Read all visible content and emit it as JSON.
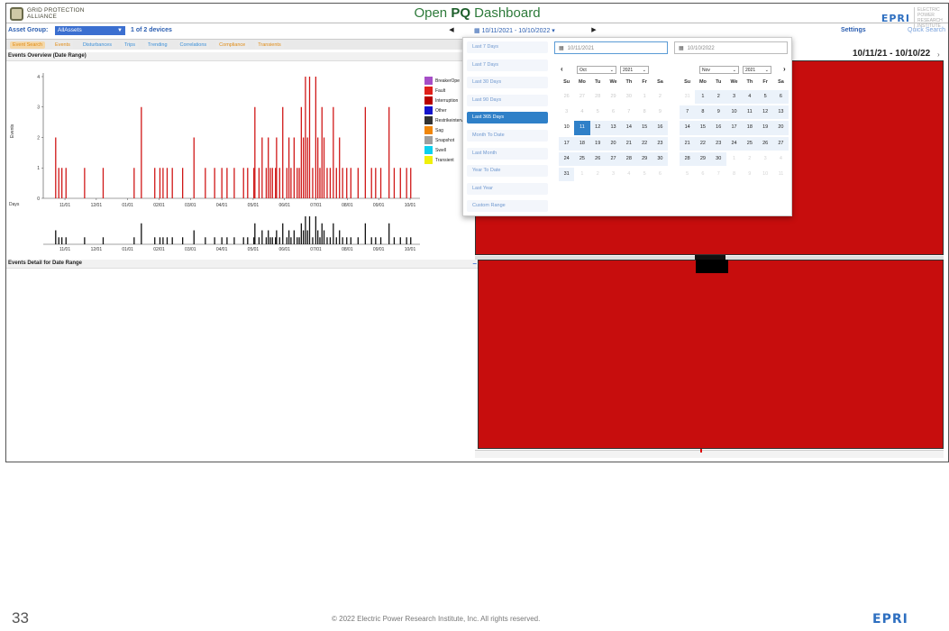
{
  "header": {
    "org_line1": "GRID PROTECTION",
    "org_line2": "ALLIANCE",
    "title_pre": "Open ",
    "title_bold": "PQ",
    "title_post": " Dashboard",
    "epri": "EPRI",
    "epri_tagline": "ELECTRIC POWER RESEARCH INSTITUTE"
  },
  "toolbar": {
    "asset_label": "Asset Group:",
    "asset_value": "AllAssets",
    "devices": "1 of 2 devices",
    "prev": "◀",
    "date_range": "10/11/2021 - 10/10/2022",
    "next": "▶",
    "settings": "Settings",
    "quick_search": "Quick Search"
  },
  "tabs": [
    {
      "label": "Event Search",
      "color": "#e08a12",
      "bg": "#f4d7a8"
    },
    {
      "label": "Events",
      "color": "#e08a12",
      "bg": "#eaeaea"
    },
    {
      "label": "Disturbances",
      "color": "#3b8fd8",
      "bg": "#eaeaea"
    },
    {
      "label": "Trips",
      "color": "#3b8fd8",
      "bg": "#eaeaea"
    },
    {
      "label": "Trending",
      "color": "#3b8fd8",
      "bg": "#eaeaea"
    },
    {
      "label": "Correlations",
      "color": "#3b8fd8",
      "bg": "#eaeaea"
    },
    {
      "label": "Compliance",
      "color": "#e08a12",
      "bg": "#eaeaea"
    },
    {
      "label": "Transients",
      "color": "#e08a12",
      "bg": "#eaeaea"
    }
  ],
  "overview": {
    "title": "Events Overview (Date Range)",
    "ylabel": "Events",
    "days_label": "Days",
    "ticks": [
      "11/01",
      "12/01",
      "01/01",
      "02/01",
      "03/01",
      "04/01",
      "05/01",
      "06/01",
      "07/01",
      "08/01",
      "09/01",
      "10/01"
    ],
    "legend": [
      {
        "label": "BreakerOpe",
        "color": "#a64ec7"
      },
      {
        "label": "Fault",
        "color": "#e0201a"
      },
      {
        "label": "Interruption",
        "color": "#b80000"
      },
      {
        "label": "Other",
        "color": "#1414cc"
      },
      {
        "label": "Restrikeinterval",
        "color": "#333333"
      },
      {
        "label": "Sag",
        "color": "#f0860a"
      },
      {
        "label": "Snapshot",
        "color": "#9e9e9e"
      },
      {
        "label": "Swell",
        "color": "#0cd0ee"
      },
      {
        "label": "Transient",
        "color": "#f0f00a"
      }
    ]
  },
  "chart_data": {
    "type": "bar",
    "xlabel": "Days",
    "ylabel": "Events",
    "ylim": [
      0,
      4
    ],
    "yticks": [
      0,
      1,
      2,
      3,
      4
    ],
    "x_ticks": [
      "11/01",
      "12/01",
      "01/01",
      "02/01",
      "03/01",
      "04/01",
      "05/01",
      "06/01",
      "07/01",
      "08/01",
      "09/01",
      "10/01"
    ],
    "x_range_days": [
      0,
      365
    ],
    "series": [
      {
        "name": "Fault",
        "color": "#d01818",
        "day": [
          12,
          15,
          18,
          22,
          40,
          58,
          88,
          95,
          108,
          113,
          116,
          120,
          125,
          135,
          146,
          157,
          166,
          173,
          178,
          185,
          194,
          198,
          204,
          205,
          209,
          212,
          216,
          218,
          220,
          222,
          225,
          226,
          229,
          232,
          236,
          238,
          240,
          243,
          246,
          248,
          250,
          252,
          254,
          256,
          258,
          261,
          264,
          266,
          268,
          270,
          272,
          275,
          278,
          281,
          284,
          287,
          290,
          294,
          298,
          305,
          312,
          318,
          322,
          327,
          335,
          340,
          346,
          352,
          356
        ],
        "value": [
          2,
          1,
          1,
          1,
          1,
          1,
          1,
          3,
          1,
          1,
          1,
          1,
          1,
          1,
          2,
          1,
          1,
          1,
          1,
          1,
          1,
          1,
          1,
          3,
          1,
          2,
          1,
          2,
          1,
          1,
          1,
          2,
          1,
          3,
          1,
          2,
          1,
          2,
          1,
          1,
          3,
          2,
          4,
          2,
          4,
          1,
          4,
          2,
          1,
          3,
          2,
          1,
          1,
          3,
          1,
          2,
          1,
          1,
          1,
          1,
          3,
          1,
          1,
          1,
          3,
          1,
          1,
          1,
          1
        ]
      }
    ]
  },
  "event_detail": {
    "title": "Events Detail for Date Range",
    "minimize": "–"
  },
  "right_panel": {
    "range_display": "10/11/21 - 10/10/22",
    "scroll_glyph": "›"
  },
  "picker": {
    "ranges": [
      {
        "label": "Last 7 Days",
        "active": false
      },
      {
        "label": "Last 7 Days",
        "active": false
      },
      {
        "label": "Last 30 Days",
        "active": false
      },
      {
        "label": "Last 90 Days",
        "active": false
      },
      {
        "label": "Last 365 Days",
        "active": true
      },
      {
        "label": "Month To Date",
        "active": false
      },
      {
        "label": "Last Month",
        "active": false
      },
      {
        "label": "Year To Date",
        "active": false
      },
      {
        "label": "Last Year",
        "active": false
      },
      {
        "label": "Custom Range",
        "active": false
      }
    ],
    "start_date": "10/11/2021",
    "end_date": "10/10/2022",
    "prev_arrow": "‹",
    "next_arrow": "›",
    "left_month": "Oct",
    "left_year": "2021",
    "right_month": "Nov",
    "right_year": "2021",
    "dow": [
      "Su",
      "Mo",
      "Tu",
      "We",
      "Th",
      "Fr",
      "Sa"
    ],
    "left_weeks": [
      [
        {
          "d": "26",
          "s": "out"
        },
        {
          "d": "27",
          "s": "out"
        },
        {
          "d": "28",
          "s": "out"
        },
        {
          "d": "29",
          "s": "out"
        },
        {
          "d": "30",
          "s": "out"
        },
        {
          "d": "1",
          "s": "out"
        },
        {
          "d": "2",
          "s": "out"
        }
      ],
      [
        {
          "d": "3",
          "s": "out"
        },
        {
          "d": "4",
          "s": "out"
        },
        {
          "d": "5",
          "s": "out"
        },
        {
          "d": "6",
          "s": "out"
        },
        {
          "d": "7",
          "s": "out"
        },
        {
          "d": "8",
          "s": "out"
        },
        {
          "d": "9",
          "s": "out"
        }
      ],
      [
        {
          "d": "10",
          "s": ""
        },
        {
          "d": "11",
          "s": "sel"
        },
        {
          "d": "12",
          "s": "inr"
        },
        {
          "d": "13",
          "s": "inr"
        },
        {
          "d": "14",
          "s": "inr"
        },
        {
          "d": "15",
          "s": "inr"
        },
        {
          "d": "16",
          "s": "inr"
        }
      ],
      [
        {
          "d": "17",
          "s": "inr"
        },
        {
          "d": "18",
          "s": "inr"
        },
        {
          "d": "19",
          "s": "inr"
        },
        {
          "d": "20",
          "s": "inr"
        },
        {
          "d": "21",
          "s": "inr"
        },
        {
          "d": "22",
          "s": "inr"
        },
        {
          "d": "23",
          "s": "inr"
        }
      ],
      [
        {
          "d": "24",
          "s": "inr"
        },
        {
          "d": "25",
          "s": "inr"
        },
        {
          "d": "26",
          "s": "inr"
        },
        {
          "d": "27",
          "s": "inr"
        },
        {
          "d": "28",
          "s": "inr"
        },
        {
          "d": "29",
          "s": "inr"
        },
        {
          "d": "30",
          "s": "inr"
        }
      ],
      [
        {
          "d": "31",
          "s": "inr"
        },
        {
          "d": "1",
          "s": "muted"
        },
        {
          "d": "2",
          "s": "muted"
        },
        {
          "d": "3",
          "s": "muted"
        },
        {
          "d": "4",
          "s": "muted"
        },
        {
          "d": "5",
          "s": "muted"
        },
        {
          "d": "6",
          "s": "muted"
        }
      ]
    ],
    "right_weeks": [
      [
        {
          "d": "31",
          "s": "muted"
        },
        {
          "d": "1",
          "s": "inr"
        },
        {
          "d": "2",
          "s": "inr"
        },
        {
          "d": "3",
          "s": "inr"
        },
        {
          "d": "4",
          "s": "inr"
        },
        {
          "d": "5",
          "s": "inr"
        },
        {
          "d": "6",
          "s": "inr"
        }
      ],
      [
        {
          "d": "7",
          "s": "inr"
        },
        {
          "d": "8",
          "s": "inr"
        },
        {
          "d": "9",
          "s": "inr"
        },
        {
          "d": "10",
          "s": "inr"
        },
        {
          "d": "11",
          "s": "inr"
        },
        {
          "d": "12",
          "s": "inr"
        },
        {
          "d": "13",
          "s": "inr"
        }
      ],
      [
        {
          "d": "14",
          "s": "inr"
        },
        {
          "d": "15",
          "s": "inr"
        },
        {
          "d": "16",
          "s": "inr"
        },
        {
          "d": "17",
          "s": "inr"
        },
        {
          "d": "18",
          "s": "inr"
        },
        {
          "d": "19",
          "s": "inr"
        },
        {
          "d": "20",
          "s": "inr"
        }
      ],
      [
        {
          "d": "21",
          "s": "inr"
        },
        {
          "d": "22",
          "s": "inr"
        },
        {
          "d": "23",
          "s": "inr"
        },
        {
          "d": "24",
          "s": "inr"
        },
        {
          "d": "25",
          "s": "inr"
        },
        {
          "d": "26",
          "s": "inr"
        },
        {
          "d": "27",
          "s": "inr"
        }
      ],
      [
        {
          "d": "28",
          "s": "inr"
        },
        {
          "d": "29",
          "s": "inr"
        },
        {
          "d": "30",
          "s": "inr"
        },
        {
          "d": "1",
          "s": "muted"
        },
        {
          "d": "2",
          "s": "muted"
        },
        {
          "d": "3",
          "s": "muted"
        },
        {
          "d": "4",
          "s": "muted"
        }
      ],
      [
        {
          "d": "5",
          "s": "muted"
        },
        {
          "d": "6",
          "s": "muted"
        },
        {
          "d": "7",
          "s": "muted"
        },
        {
          "d": "8",
          "s": "muted"
        },
        {
          "d": "9",
          "s": "muted"
        },
        {
          "d": "10",
          "s": "muted"
        },
        {
          "d": "11",
          "s": "muted"
        }
      ]
    ]
  },
  "footer": {
    "slide_number": "33",
    "copyright": "© 2022 Electric Power Research Institute, Inc. All rights reserved.",
    "epri": "EPRI"
  }
}
